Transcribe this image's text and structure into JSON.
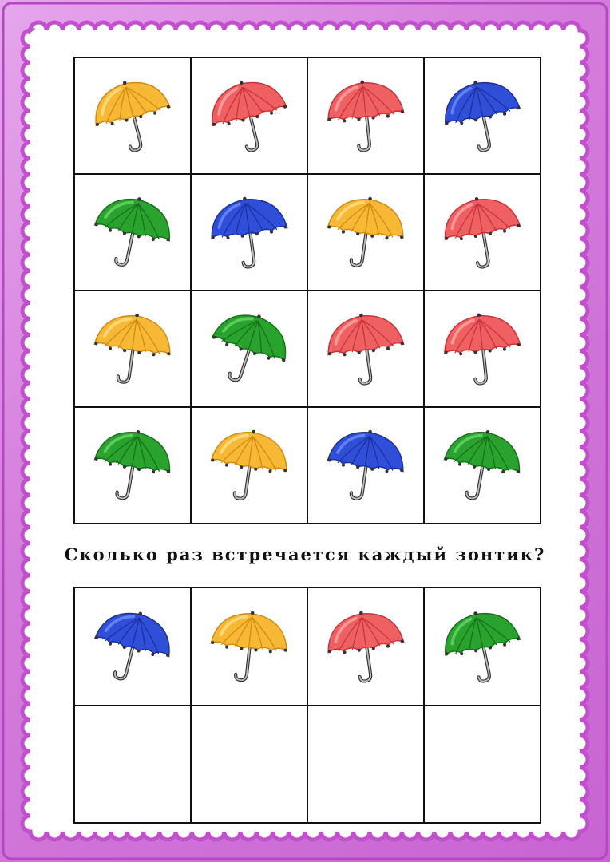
{
  "question": "Сколько раз встречается каждый зонтик?",
  "colors": {
    "yellow": {
      "fill": "#f7b935",
      "light": "#fde18a",
      "dark": "#d18a12"
    },
    "red": {
      "fill": "#ef6063",
      "light": "#fca6a6",
      "dark": "#c93338"
    },
    "blue": {
      "fill": "#2f4fd8",
      "light": "#6f8cf5",
      "dark": "#1c2f9c"
    },
    "green": {
      "fill": "#2aa32e",
      "light": "#6ad56a",
      "dark": "#17701b"
    }
  },
  "grid": [
    {
      "color": "yellow",
      "tilt": -14
    },
    {
      "color": "red",
      "tilt": -14
    },
    {
      "color": "red",
      "tilt": -6
    },
    {
      "color": "blue",
      "tilt": -12
    },
    {
      "color": "green",
      "tilt": 12
    },
    {
      "color": "blue",
      "tilt": -8
    },
    {
      "color": "yellow",
      "tilt": 8
    },
    {
      "color": "red",
      "tilt": -10
    },
    {
      "color": "yellow",
      "tilt": 8
    },
    {
      "color": "green",
      "tilt": 18
    },
    {
      "color": "red",
      "tilt": -8
    },
    {
      "color": "red",
      "tilt": -6
    },
    {
      "color": "green",
      "tilt": 10
    },
    {
      "color": "yellow",
      "tilt": 8
    },
    {
      "color": "blue",
      "tilt": 8
    },
    {
      "color": "green",
      "tilt": 10
    }
  ],
  "answer_row": [
    {
      "color": "blue",
      "tilt": 14
    },
    {
      "color": "yellow",
      "tilt": 6
    },
    {
      "color": "red",
      "tilt": -8
    },
    {
      "color": "green",
      "tilt": -12
    }
  ],
  "answer_blanks": [
    "",
    "",
    "",
    ""
  ]
}
